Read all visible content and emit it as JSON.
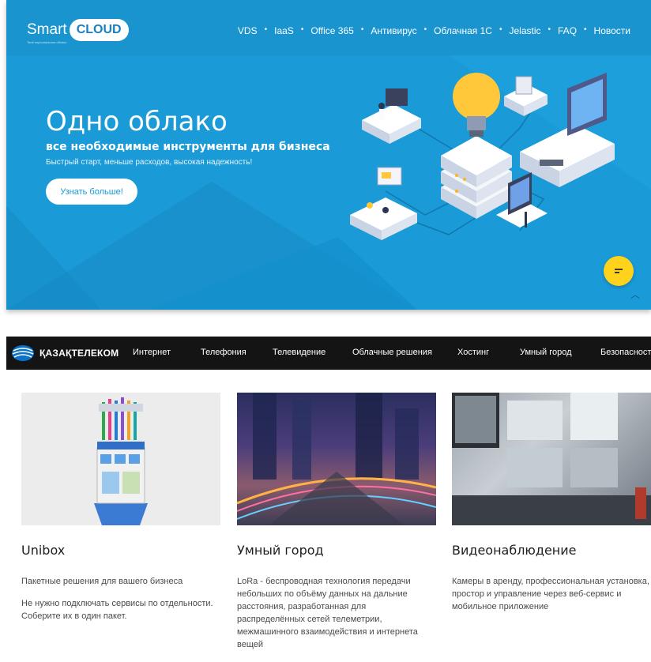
{
  "smartcloud": {
    "logo": {
      "smart": "Smart",
      "cloud": "CLOUD",
      "tagline": "Твоё персональное облако"
    },
    "nav": [
      {
        "label": "VDS"
      },
      {
        "label": "IaaS"
      },
      {
        "label": "Office 365"
      },
      {
        "label": "Антивирус"
      },
      {
        "label": "Облачная 1С"
      },
      {
        "label": "Jelastic"
      },
      {
        "label": "FAQ"
      },
      {
        "label": "Новости"
      }
    ],
    "nav_separator": "•",
    "hero": {
      "title": "Одно облако",
      "subtitle": "все необходимые инструменты для бизнеса",
      "description": "Быстрый старт, меньше расходов, высокая надежность!",
      "button": "Узнать больше!"
    },
    "colors": {
      "hero_bg": "#1a9ad6",
      "chat_button": "#ffd21c"
    },
    "icons": {
      "chat": "chat-bubble-icon",
      "scroll_up": "chevron-up-icon"
    }
  },
  "kazakhtelecom": {
    "logo": "ҚАЗАҚТЕЛЕКОМ",
    "menu": [
      {
        "label": "Интернет"
      },
      {
        "label": "Телефония"
      },
      {
        "label": "Телевидение"
      },
      {
        "label": "Облачные решения"
      },
      {
        "label": "Хостинг"
      },
      {
        "label": "Умный город"
      },
      {
        "label": "Безопасность"
      }
    ],
    "cards": [
      {
        "title": "Unibox",
        "paragraphs": [
          "Пакетные решения для вашего бизнеса",
          "Не нужно подключать сервисы по отдельности. Соберите их в один пакет."
        ]
      },
      {
        "title": "Умный город",
        "paragraphs": [
          "LoRa - беспроводная технология передачи небольших по объёму данных на дальние расстояния, разработанная для распределённых сетей телеметрии, межмашинного взаимодействия и интернета вещей"
        ]
      },
      {
        "title": "Видеонаблюдение",
        "paragraphs": [
          "Камеры в аренду, профессиональная установка, простор и управление через веб-сервис и мобильное приложение"
        ]
      }
    ],
    "colors": {
      "nav_bg": "#141414"
    }
  }
}
